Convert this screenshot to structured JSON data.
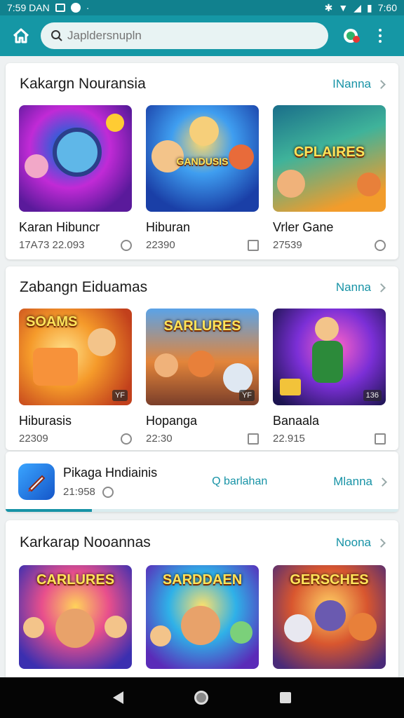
{
  "status_bar": {
    "time_left": "7:59 DAN",
    "time_right": "7:60"
  },
  "search": {
    "placeholder": "Japldersnupln"
  },
  "sections": [
    {
      "title": "Kakargn Nouransia",
      "more_label": "INanna",
      "items": [
        {
          "name": "Karan Hibuncr",
          "meta": "17A73  22.093",
          "badge": "",
          "art_title": ""
        },
        {
          "name": "Hiburan",
          "meta": "22390",
          "badge": "",
          "art_title": "GANDUSIS"
        },
        {
          "name": "Vrler Gane",
          "meta": "27539",
          "badge": "",
          "art_title": "CPLAIRES"
        }
      ]
    },
    {
      "title": "Zabangn Eiduamas",
      "more_label": "Nanna",
      "items": [
        {
          "name": "Hiburasis",
          "meta": "22309",
          "badge": "YF",
          "art_title": "SOAMS"
        },
        {
          "name": "Hopanga",
          "meta": "22:30",
          "badge": "YF",
          "art_title": "SARLURES"
        },
        {
          "name": "Banaala",
          "meta": "22.915",
          "badge": "136",
          "art_title": ""
        }
      ]
    },
    {
      "title": "Karkarap Nooannas",
      "more_label": "Noona",
      "items": [
        {
          "name": "",
          "meta": "",
          "badge": "",
          "art_title": "CARLURES"
        },
        {
          "name": "",
          "meta": "",
          "badge": "",
          "art_title": "SARDDAEN"
        },
        {
          "name": "",
          "meta": "",
          "badge": "",
          "art_title": "GERSCHES"
        }
      ]
    }
  ],
  "app_row": {
    "name": "Pikaga Hndiainis",
    "size": "21:958",
    "action_label": "Q barlahan",
    "more_label": "Mlanna",
    "progress": 0.22
  },
  "colors": {
    "accent": "#1793a6",
    "app_bar": "#1597a5",
    "status_bar": "#11818e"
  }
}
